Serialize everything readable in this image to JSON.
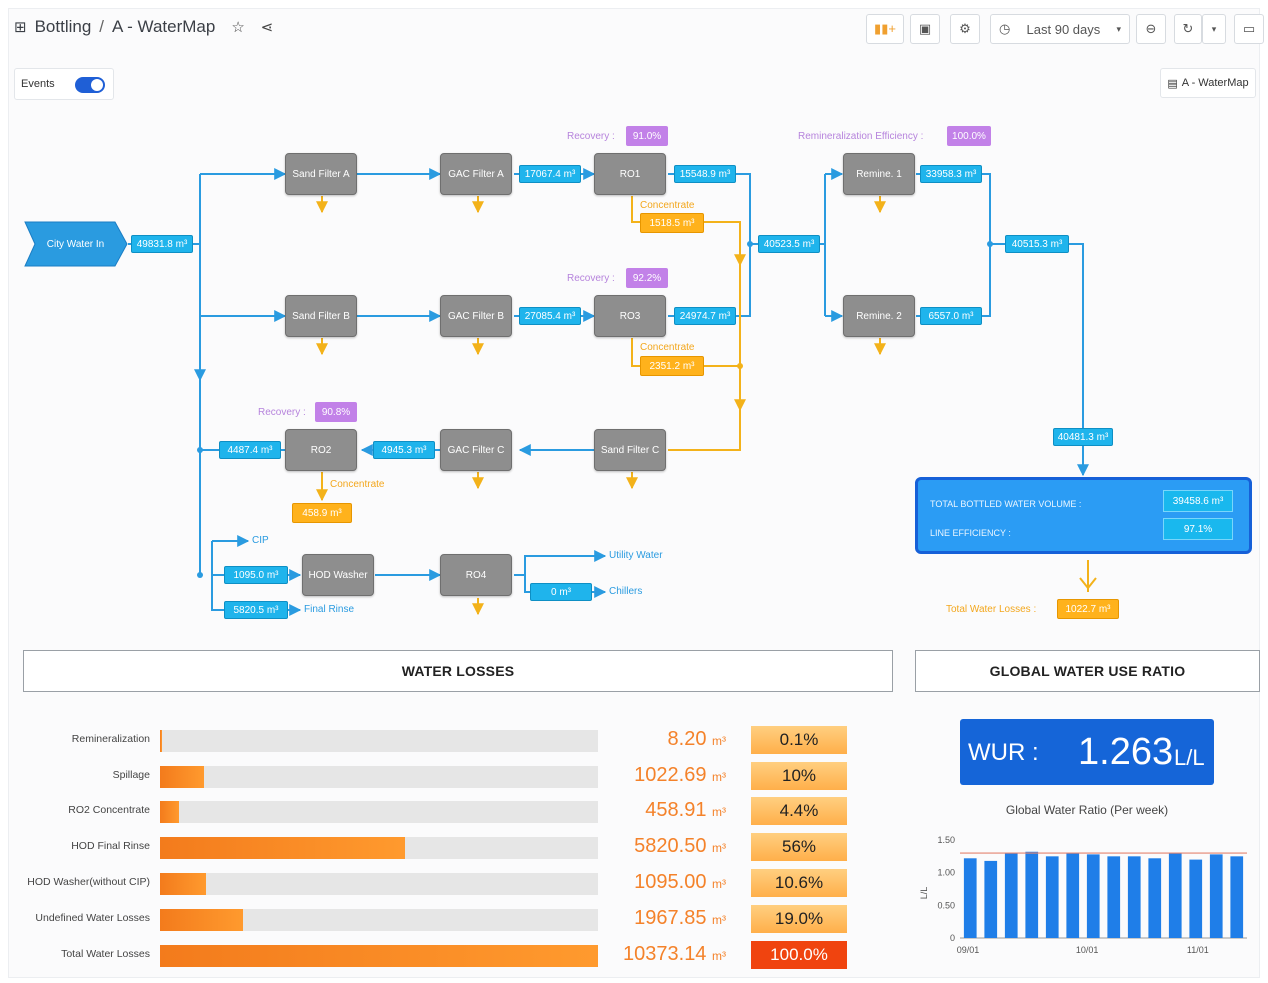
{
  "header": {
    "breadcrumb_parent": "Bottling",
    "breadcrumb_sep": "/",
    "breadcrumb_current": "A - WaterMap",
    "time_range": "Last 90 days"
  },
  "events": {
    "label": "Events",
    "enabled": true
  },
  "map_tag": "A - WaterMap",
  "flow": {
    "city_water_in": "City Water In",
    "city_value": "49831.8 m³",
    "sand_a": "Sand Filter A",
    "sand_b": "Sand Filter B",
    "sand_c": "Sand Filter C",
    "gac_a": "GAC Filter A",
    "gac_b": "GAC Filter B",
    "gac_c": "GAC Filter C",
    "ro1_top": "RO1",
    "ro1_mid": "RO3",
    "ro2": "RO2",
    "hod_washer": "HOD Washer",
    "ro4": "RO4",
    "remin1": "Remine. 1",
    "remin2": "Remine. 2",
    "gac_a_out": "17067.4 m³",
    "ro_top_out": "15548.9 m³",
    "gac_b_out": "27085.4 m³",
    "ro_mid_out": "24974.7 m³",
    "merge_out": "40523.5 m³",
    "remin1_out": "33958.3 m³",
    "remin2_out": "6557.0 m³",
    "remin_merge": "40515.3 m³",
    "down_value": "40481.3 m³",
    "ro2_in": "4945.3 m³",
    "ro2_out": "4487.4 m³",
    "hod_in": "1095.0 m³",
    "final_rinse_val": "5820.5 m³",
    "ro4_chillers": "0 m³",
    "recovery_label": "Recovery :",
    "recovery_top": "91.0%",
    "recovery_mid": "92.2%",
    "recovery_ro2": "90.8%",
    "remin_eff_label": "Remineralization Efficiency :",
    "remin_eff": "100.0%",
    "concentrate": "Concentrate",
    "conc_top": "1518.5 m³",
    "conc_mid": "2351.2 m³",
    "conc_ro2": "458.9 m³",
    "cip": "CIP",
    "final_rinse": "Final Rinse",
    "utility_water": "Utility Water",
    "chillers": "Chillers",
    "total_bottled_label": "TOTAL BOTTLED WATER VOLUME :",
    "total_bottled_value": "39458.6 m³",
    "line_eff_label": "LINE EFFICIENCY :",
    "line_eff_value": "97.1%",
    "total_loss_label": "Total Water Losses :",
    "total_loss_value": "1022.7 m³"
  },
  "losses": {
    "title": "WATER LOSSES",
    "rows": [
      {
        "label": "Remineralization",
        "value": "8.20",
        "unit": "m³",
        "pct": "0.1%",
        "fraction": 0.001
      },
      {
        "label": "Spillage",
        "value": "1022.69",
        "unit": "m³",
        "pct": "10%",
        "fraction": 0.1
      },
      {
        "label": "RO2 Concentrate",
        "value": "458.91",
        "unit": "m³",
        "pct": "4.4%",
        "fraction": 0.044
      },
      {
        "label": "HOD Final Rinse",
        "value": "5820.50",
        "unit": "m³",
        "pct": "56%",
        "fraction": 0.56
      },
      {
        "label": "HOD Washer(without CIP)",
        "value": "1095.00",
        "unit": "m³",
        "pct": "10.6%",
        "fraction": 0.106
      },
      {
        "label": "Undefined Water Losses",
        "value": "1967.85",
        "unit": "m³",
        "pct": "19.0%",
        "fraction": 0.19
      },
      {
        "label": "Total Water Losses",
        "value": "10373.14",
        "unit": "m³",
        "pct": "100.0%",
        "fraction": 1.0
      }
    ]
  },
  "global_ratio": {
    "title": "GLOBAL WATER USE RATIO",
    "wur_label": "WUR :",
    "wur_value": "1.263",
    "wur_unit": "L/L",
    "chart_title": "Global Water Ratio (Per week)"
  },
  "chart_data": {
    "type": "bar",
    "title": "Global Water Ratio (Per week)",
    "ylabel": "L/L",
    "ylim": [
      0,
      1.5
    ],
    "yticks": [
      "0",
      "0.50",
      "1.00",
      "1.50"
    ],
    "xticks": [
      "09/01",
      "10/01",
      "11/01"
    ],
    "values": [
      1.22,
      1.18,
      1.3,
      1.32,
      1.25,
      1.3,
      1.28,
      1.25,
      1.25,
      1.22,
      1.3,
      1.2,
      1.28,
      1.25
    ],
    "reference": 1.3,
    "colors": {
      "bar": "#1f7ee8",
      "reference": "#e4846f"
    }
  }
}
